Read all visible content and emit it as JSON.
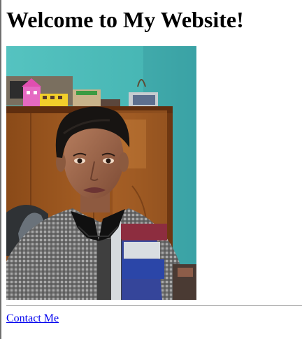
{
  "page": {
    "heading": "Welcome to My Website!",
    "photo_alt": "Selfie of a young man in a room",
    "contact_link": "Contact Me"
  },
  "colors": {
    "heading": "#000000",
    "link": "#0000ee",
    "divider": "#8f8f8f",
    "page_background": "#ffffff"
  }
}
